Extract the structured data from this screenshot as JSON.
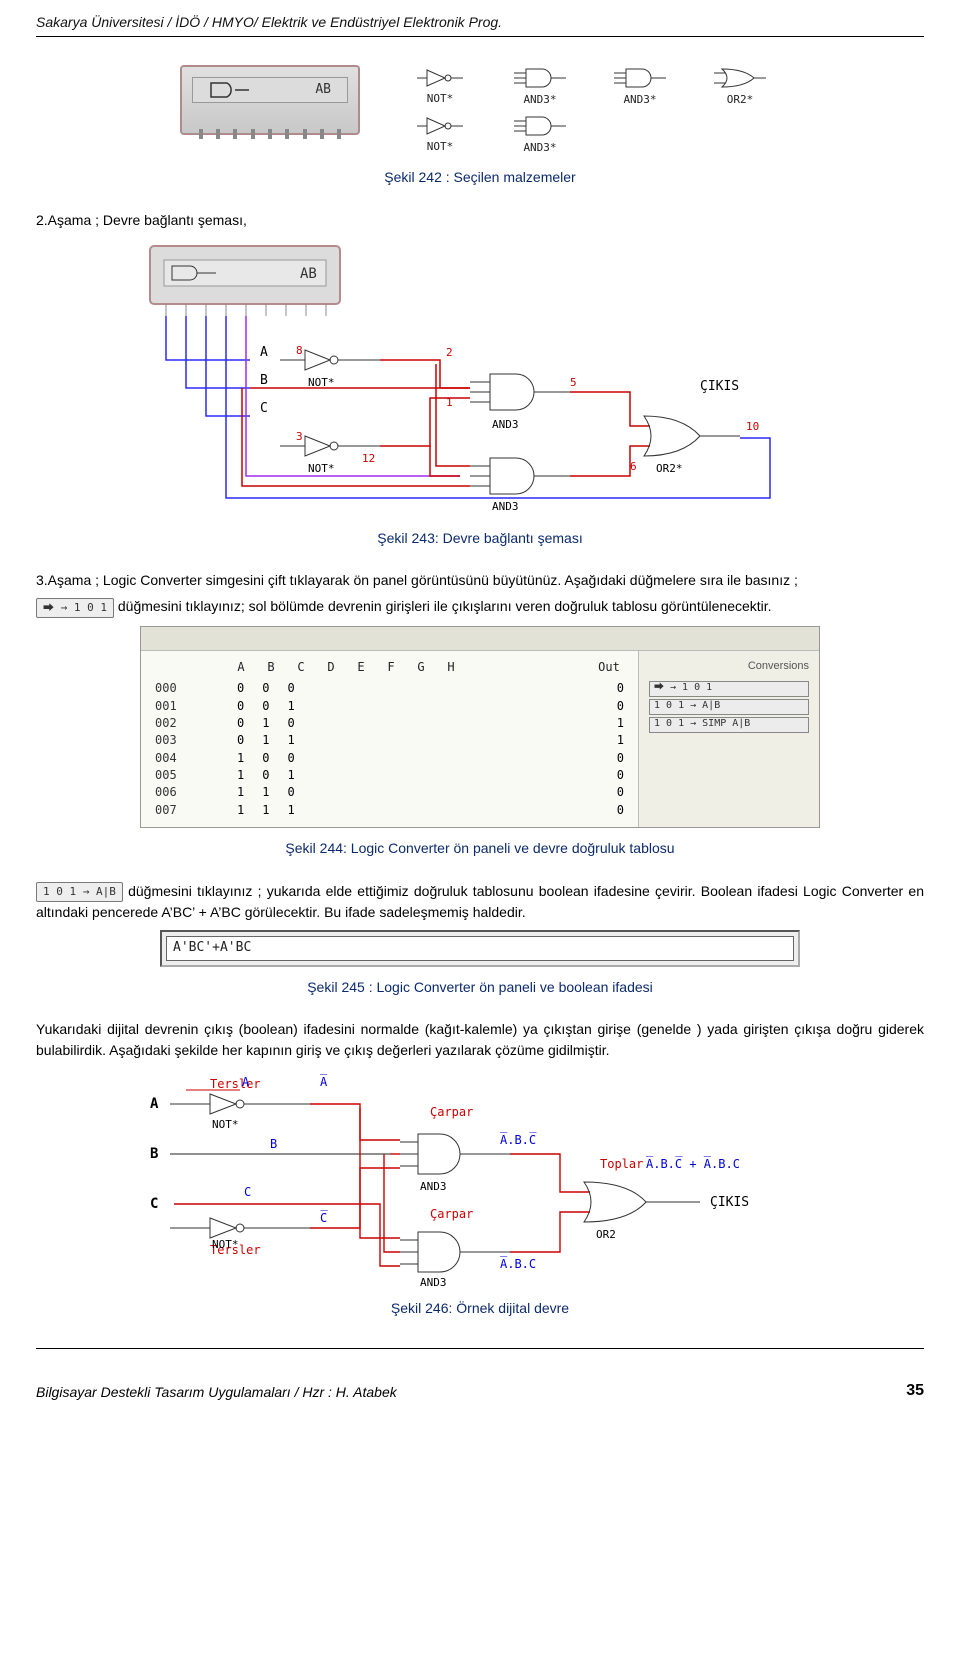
{
  "header": "Sakarya Üniversitesi / İDÖ / HMYO/ Elektrik ve  Endüstriyel Elektronik Prog.",
  "dip": {
    "label": "AB"
  },
  "gates": {
    "r1": [
      "NOT*",
      "AND3*",
      "AND3*",
      "OR2*"
    ],
    "r2": [
      "NOT*",
      "AND3*",
      "",
      ""
    ]
  },
  "caption242": "Şekil 242 : Seçilen malzemeler",
  "step2": "2.Aşama ; Devre bağlantı şeması,",
  "fig243": {
    "dipLabel": "AB",
    "inputs": [
      "A",
      "B",
      "C"
    ],
    "gateLabels": [
      "NOT*",
      "NOT*",
      "AND3",
      "AND3",
      "OR2*"
    ],
    "nodeNums": [
      "8",
      "3",
      "2",
      "1",
      "12",
      "5",
      "6",
      "10"
    ],
    "output": "ÇIKIS"
  },
  "caption243": "Şekil 243: Devre bağlantı şeması",
  "step3a": "3.Aşama ; Logic Converter simgesini çift tıklayarak ön panel görüntüsünü büyütünüz. Aşağıdaki düğmelere sıra ile  basınız ;",
  "step3b_btn": "⮕  → 1 0 1",
  "step3b": " düğmesini tıklayınız; sol bölümde   devrenin girişleri ile çıkışlarını veren doğruluk tablosu görüntülenecektir.",
  "truthTable": {
    "headers": [
      "A",
      "B",
      "C",
      "D",
      "E",
      "F",
      "G",
      "H"
    ],
    "outHeader": "Out",
    "conversionsLabel": "Conversions",
    "rows": [
      {
        "idx": "000",
        "bits": [
          "0",
          "0",
          "0"
        ],
        "out": "0"
      },
      {
        "idx": "001",
        "bits": [
          "0",
          "0",
          "1"
        ],
        "out": "0"
      },
      {
        "idx": "002",
        "bits": [
          "0",
          "1",
          "0"
        ],
        "out": "1"
      },
      {
        "idx": "003",
        "bits": [
          "0",
          "1",
          "1"
        ],
        "out": "1"
      },
      {
        "idx": "004",
        "bits": [
          "1",
          "0",
          "0"
        ],
        "out": "0"
      },
      {
        "idx": "005",
        "bits": [
          "1",
          "0",
          "1"
        ],
        "out": "0"
      },
      {
        "idx": "006",
        "bits": [
          "1",
          "1",
          "0"
        ],
        "out": "0"
      },
      {
        "idx": "007",
        "bits": [
          "1",
          "1",
          "1"
        ],
        "out": "0"
      }
    ],
    "sideButtons": [
      "⮕ → 1 0 1",
      "1 0 1 → A|B",
      "1 0 1 → SIMP A|B"
    ]
  },
  "caption244": "Şekil  244: Logic Converter ön paneli ve devre  doğruluk tablosu",
  "para4_btn": "1 0 1  →  A|B",
  "para4": " düğmesini tıklayınız ; yukarıda elde ettiğimiz doğruluk tablosunu  boolean ifadesine çevirir. Boolean ifadesi Logic Converter   en altındaki pencerede A’BC’ + A’BC görülecektir. Bu ifade sadeleşmemiş haldedir.",
  "exprValue": "A'BC'+A'BC",
  "caption245": "Şekil 245 : Logic Converter ön paneli ve boolean ifadesi",
  "para5": "Yukarıdaki dijital devrenin  çıkış (boolean) ifadesini normalde (kağıt-kalemle)  ya çıkıştan girişe (genelde ) yada  girişten çıkışa doğru giderek bulabilirdik. Aşağıdaki şekilde   her kapının giriş ve çıkış değerleri yazılarak çözüme gidilmiştir.",
  "fig246": {
    "inputs": [
      "A",
      "B",
      "C"
    ],
    "labels": {
      "tersler": "Tersler",
      "carpar": "Çarpar",
      "toplar": "Toplar",
      "not": "NOT*",
      "and": "AND3",
      "or": "OR2",
      "out": "ÇIKIS",
      "Abar": "A̅",
      "Bbar": "B",
      "Cbar": "C̅",
      "t1": "A̅.B.C̅",
      "t2": "A̅.B.C",
      "sum": "A̅.B.C̅ + A̅.B.C"
    }
  },
  "caption246": "Şekil  246: Örnek dijital devre",
  "footerLeft": "Bilgisayar Destekli Tasarım Uygulamaları / Hzr :  H. Atabek",
  "footerRight": "35"
}
